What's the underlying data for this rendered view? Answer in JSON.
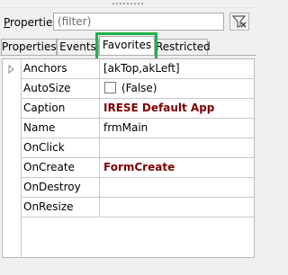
{
  "filter": {
    "label_prefix": "P",
    "label_rest": "roperties",
    "placeholder": "(filter)"
  },
  "tabs": [
    {
      "label": "Properties",
      "active": false
    },
    {
      "label": "Events",
      "active": false
    },
    {
      "label": "Favorites",
      "active": true
    },
    {
      "label": "Restricted",
      "active": false
    }
  ],
  "colors": {
    "highlight": "#22b14c",
    "bold_value": "#800000"
  },
  "grid": {
    "rows": [
      {
        "name": "Anchors",
        "value": "[akTop,akLeft]",
        "expandable": true
      },
      {
        "name": "AutoSize",
        "value": "(False)",
        "checkbox": true
      },
      {
        "name": "Caption",
        "value": "IRESE Default App",
        "bold": true
      },
      {
        "name": "Name",
        "value": "frmMain"
      },
      {
        "name": "OnClick",
        "value": ""
      },
      {
        "name": "OnCreate",
        "value": "FormCreate",
        "bold": true
      },
      {
        "name": "OnDestroy",
        "value": ""
      },
      {
        "name": "OnResize",
        "value": ""
      }
    ]
  },
  "icons": {
    "expand": "triangle-right-icon",
    "clear_filter": "clear-filter-icon"
  }
}
